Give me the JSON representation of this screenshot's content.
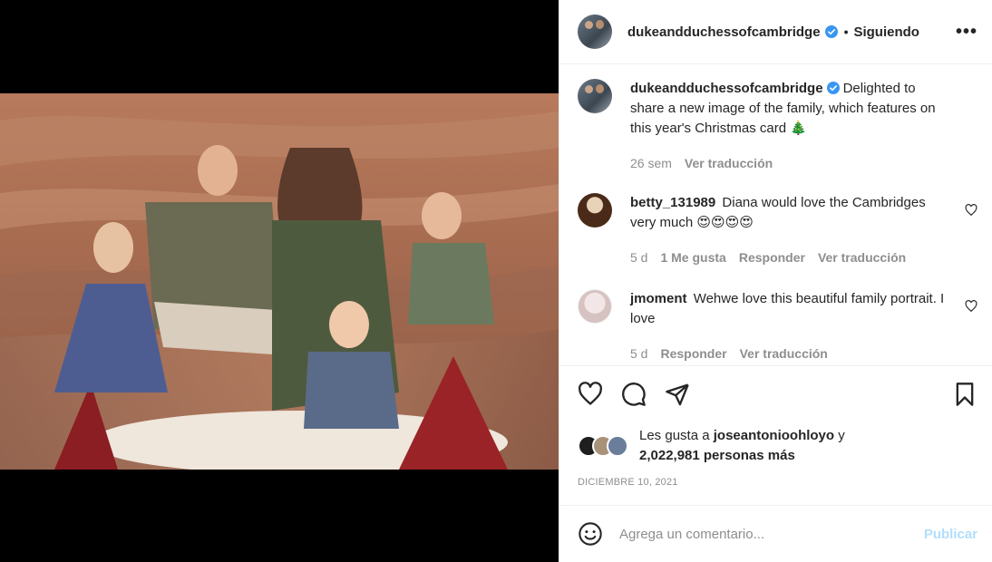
{
  "post": {
    "username": "dukeandduchessofcambridge",
    "separator": "•",
    "following_label": "Siguiendo",
    "more_label": "•••"
  },
  "caption": {
    "username": "dukeandduchessofcambridge",
    "text": "Delighted to share a new image of the family, which features on this year's Christmas card 🎄",
    "time": "26 sem",
    "translate": "Ver traducción"
  },
  "comments": [
    {
      "username": "betty_131989",
      "text": "Diana would love the Cambridges very much 😍😍😍😍",
      "time": "5 d",
      "likes": "1 Me gusta",
      "reply": "Responder",
      "translate": "Ver traducción"
    },
    {
      "username": "jmoment",
      "text": "Wehwe love this beautiful family portrait. I love",
      "time": "5 d",
      "reply": "Responder",
      "translate": "Ver traducción"
    }
  ],
  "likes": {
    "prefix": "Les gusta a",
    "user": "joseantonioohloyo",
    "conj": "y",
    "count": "2,022,981 personas más"
  },
  "date": "DICIEMBRE 10, 2021",
  "add_comment": {
    "placeholder": "Agrega un comentario...",
    "publish": "Publicar"
  },
  "colors": {
    "verified": "#3897f0",
    "publish_disabled": "#b2dffc"
  }
}
